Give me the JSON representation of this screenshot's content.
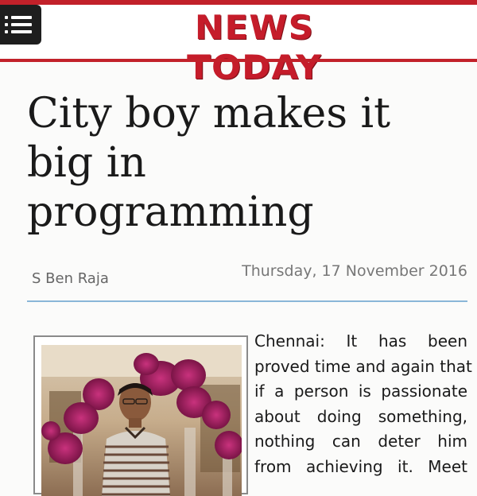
{
  "header": {
    "logo_text": "NEWS TODAY",
    "menu_icon": "menu-icon",
    "brand_color": "#c51c2a"
  },
  "article": {
    "headline_lines": [
      "City boy makes it",
      "big in",
      "programming"
    ],
    "author": "S Ben Raja",
    "date": "Thursday, 17 November 2016",
    "body_lines": [
      "Chennai: It has been",
      "proved time and again that",
      "if a person is passionate",
      "about doing something,",
      "nothing can deter him",
      "from achieving it. Meet"
    ],
    "divider_color": "#8ab6d8"
  }
}
